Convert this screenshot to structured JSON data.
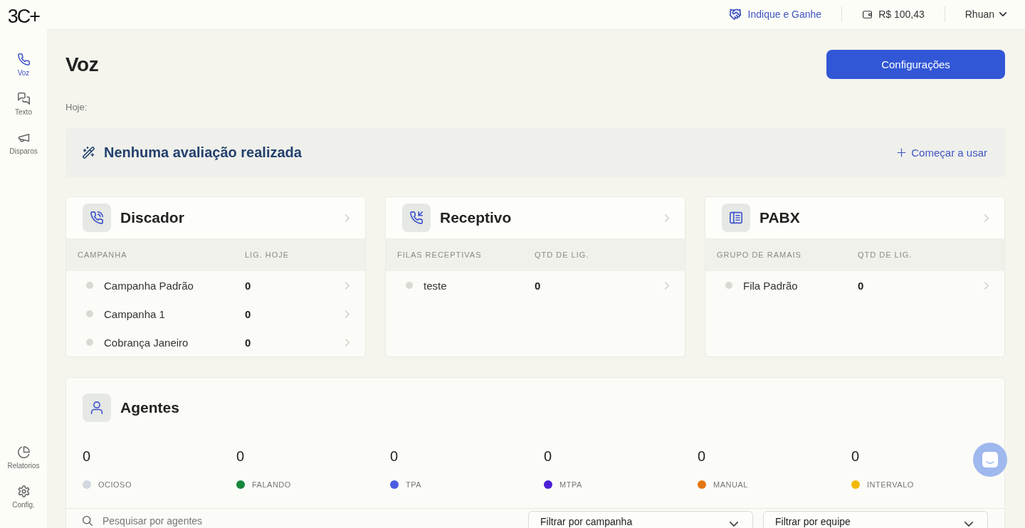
{
  "sidebar": {
    "logo": "3C+",
    "items": [
      {
        "label": "Voz",
        "selected": true
      },
      {
        "label": "Texto",
        "selected": false
      },
      {
        "label": "Disparos",
        "selected": false
      }
    ],
    "bottom_items": [
      {
        "label": "Relatorios",
        "selected": false
      },
      {
        "label": "Config.",
        "selected": false
      }
    ]
  },
  "top_bar": {
    "referral_link": "Indique e Ganhe",
    "balance": "R$ 100,43",
    "user": "Rhuan"
  },
  "header": {
    "title": "Voz",
    "button": "Configurações",
    "date_label": "Hoje:"
  },
  "evaluation_banner": {
    "message": "Nenhuma avaliação realizada",
    "action": "Começar a usar"
  },
  "summary_cards": [
    {
      "title": "Discador",
      "columns": [
        "CAMPANHA",
        "LIG. HOJE"
      ],
      "rows": [
        {
          "name": "Campanha Padrão",
          "count": "0"
        },
        {
          "name": "Campanha 1",
          "count": "0"
        },
        {
          "name": "Cobrança Janeiro",
          "count": "0"
        }
      ]
    },
    {
      "title": "Receptivo",
      "columns": [
        "FILAS RECEPTIVAS",
        "QTD DE LIG."
      ],
      "rows": [
        {
          "name": "teste",
          "count": "0"
        }
      ]
    },
    {
      "title": "PABX",
      "columns": [
        "GRUPO DE RAMAIS",
        "QTD DE LIG."
      ],
      "rows": [
        {
          "name": "Fila Padrão",
          "count": "0"
        }
      ]
    }
  ],
  "agents": {
    "title": "Agentes",
    "stats": [
      {
        "value": "0",
        "label": "OCIOSO",
        "color": "#d3d8e0"
      },
      {
        "value": "0",
        "label": "FALANDO",
        "color": "#17873b"
      },
      {
        "value": "0",
        "label": "TPA",
        "color": "#4a5ce2"
      },
      {
        "value": "0",
        "label": "MTPA",
        "color": "#4b1fd6"
      },
      {
        "value": "0",
        "label": "MANUAL",
        "color": "#e5760f"
      },
      {
        "value": "0",
        "label": "INTERVALO",
        "color": "#f4b800"
      }
    ],
    "search": {
      "placeholder": "Pesquisar por agentes"
    },
    "filters": [
      {
        "placeholder": "Filtrar por campanha"
      },
      {
        "placeholder": "Filtrar por equipe"
      }
    ]
  }
}
